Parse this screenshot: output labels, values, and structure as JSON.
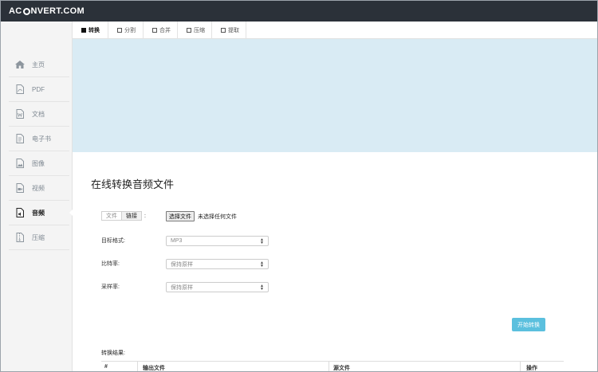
{
  "brand": {
    "left": "AC",
    "right": "NVERT.COM"
  },
  "sidebar": {
    "items": [
      {
        "label": "主页",
        "icon": "home-icon"
      },
      {
        "label": "PDF",
        "icon": "pdf-icon"
      },
      {
        "label": "文档",
        "icon": "document-icon"
      },
      {
        "label": "电子书",
        "icon": "ebook-icon"
      },
      {
        "label": "图像",
        "icon": "image-icon"
      },
      {
        "label": "视频",
        "icon": "video-icon"
      },
      {
        "label": "音频",
        "icon": "audio-icon",
        "active": true
      },
      {
        "label": "压缩",
        "icon": "archive-icon"
      }
    ]
  },
  "tabs": [
    {
      "label": "转换",
      "active": true
    },
    {
      "label": "分割"
    },
    {
      "label": "合并"
    },
    {
      "label": "压缩"
    },
    {
      "label": "提取"
    }
  ],
  "main": {
    "title": "在线转换音频文件",
    "source_toggle": {
      "file": "文件",
      "link": "链接",
      "colon": ":"
    },
    "file_button": "选择文件",
    "file_status": "未选择任何文件",
    "fields": [
      {
        "label": "目标格式:",
        "value": "MP3"
      },
      {
        "label": "比特率:",
        "value": "保持原样"
      },
      {
        "label": "采样率:",
        "value": "保持原样"
      }
    ],
    "start_button": "开始转换",
    "results_label": "转换结果:",
    "results_columns": [
      "#",
      "输出文件",
      "源文件",
      "操作"
    ]
  },
  "colors": {
    "topbar": "#2b3139",
    "banner": "#d9ebf4",
    "accent": "#5bc0de"
  }
}
